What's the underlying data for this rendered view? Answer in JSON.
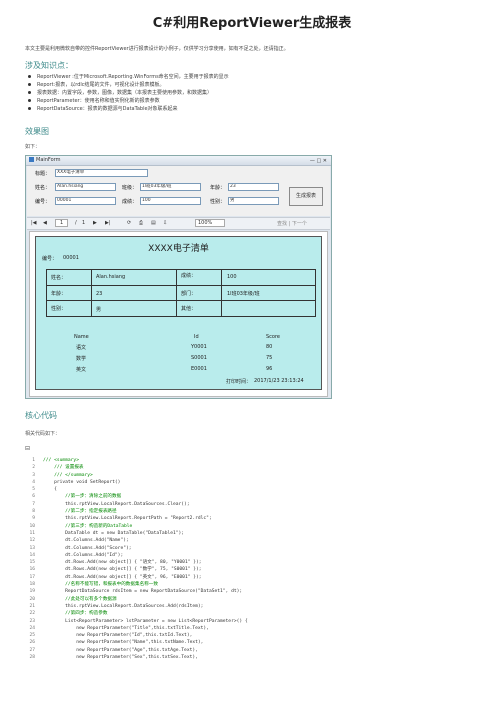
{
  "page": {
    "title": "C#利用ReportViewer生成报表",
    "intro": "本文主要是利用微软自带的控件ReportViewer进行报表设计的小例子，仅供学习分享使用，如有不足之处，还请指正。",
    "section_knowledge": "涉及知识点：",
    "knowledge_items": [
      "ReportViewer :位于Microsoft.Reporting.WinForms命名空间，主要用于报表的显示",
      "Report:报表，以rdlc结尾的文件，可视化设计报表模板。",
      "报表数据：内置字段，参数，图像，数据集（本报表主要使用参数，和数据集）",
      "ReportParameter：使用名称和值实例化新的报表参数",
      "ReportDataSource：报表的数据源与DataTable对象联系起来"
    ],
    "section_effect": "效果图",
    "effect_caption": "如下：",
    "section_code": "核心代码",
    "code_caption": "相关代码如下：",
    "code_toggle": "⊟"
  },
  "window": {
    "title": "MainForm",
    "controls": "— □ ✕",
    "labels": {
      "title": "标题：",
      "name": "姓名：",
      "class": "班级：",
      "age": "年龄：",
      "no": "编号：",
      "score": "成绩：",
      "sex": "性别："
    },
    "values": {
      "title": "XXX电子清单",
      "name": "Alan.hsiang",
      "class": "1l班03年级/班",
      "age": "23",
      "no": "00001",
      "score": "100",
      "sex": "男"
    },
    "generate_button": "生成报表",
    "toolbar": {
      "first": "|◀",
      "prev": "◀",
      "page": "1",
      "of": "/",
      "total": "1",
      "next": "▶",
      "last": "▶|",
      "zoom": "100%",
      "find": "查找 | 下一个"
    }
  },
  "report": {
    "title": "XXXX电子清单",
    "no_label": "编号：",
    "no_value": "00001",
    "name_label": "姓名：",
    "name_value": "Alan.hsiang",
    "score_label": "成绩：",
    "score_value": "100",
    "age_label": "年龄：",
    "age_value": "23",
    "dept_label": "部门：",
    "dept_value": "1l班03年级/班",
    "sex_label": "性别：",
    "sex_value": "男",
    "other_label": "其他：",
    "table_headers": [
      "Name",
      "Id",
      "Score"
    ],
    "table_rows": [
      [
        "语文",
        "Y0001",
        "80"
      ],
      [
        "数学",
        "S0001",
        "75"
      ],
      [
        "英文",
        "E0001",
        "96"
      ]
    ],
    "print_label": "打印时间：",
    "print_time": "2017/1/23 23:13:24"
  },
  "code_lines": [
    {
      "no": "1",
      "text": "/// <summary>"
    },
    {
      "no": "2",
      "text": "    /// 设置报表"
    },
    {
      "no": "3",
      "text": "    /// </summary>"
    },
    {
      "no": "4",
      "text": "    private void SetReport()"
    },
    {
      "no": "5",
      "text": "    {"
    },
    {
      "no": "6",
      "text": "        //第一步：清除之前的数据"
    },
    {
      "no": "7",
      "text": "        this.rptView.LocalReport.DataSources.Clear();"
    },
    {
      "no": "8",
      "text": "        //第二步：指定报表路径"
    },
    {
      "no": "9",
      "text": "        this.rptView.LocalReport.ReportPath = \"Report2.rdlc\";"
    },
    {
      "no": "10",
      "text": "        //第三步：构造新的DataTable"
    },
    {
      "no": "11",
      "text": "        DataTable dt = new DataTable(\"DataTable1\");"
    },
    {
      "no": "12",
      "text": "        dt.Columns.Add(\"Name\");"
    },
    {
      "no": "13",
      "text": "        dt.Columns.Add(\"Score\");"
    },
    {
      "no": "14",
      "text": "        dt.Columns.Add(\"Id\");"
    },
    {
      "no": "15",
      "text": "        dt.Rows.Add(new object[] { \"语文\", 80, \"Y0001\" });"
    },
    {
      "no": "16",
      "text": "        dt.Rows.Add(new object[] { \"数学\", 75, \"S0001\" });"
    },
    {
      "no": "17",
      "text": "        dt.Rows.Add(new object[] { \"英文\", 96, \"E0001\" });"
    },
    {
      "no": "18",
      "text": "        //名称不能写错，和报表中的数据集名称一致"
    },
    {
      "no": "19",
      "text": "        ReportDataSource rdsItem = new ReportDataSource(\"DataSet1\", dt);"
    },
    {
      "no": "20",
      "text": "        //此处可以有多个数据源"
    },
    {
      "no": "21",
      "text": "        this.rptView.LocalReport.DataSources.Add(rdsItem);"
    },
    {
      "no": "22",
      "text": "        //第四步：构造参数"
    },
    {
      "no": "23",
      "text": "        List<ReportParameter> lstParameter = new List<ReportParameter>() {"
    },
    {
      "no": "24",
      "text": "            new ReportParameter(\"Title\",this.txtTitle.Text),"
    },
    {
      "no": "25",
      "text": "            new ReportParameter(\"Id\",this.txtId.Text),"
    },
    {
      "no": "26",
      "text": "            new ReportParameter(\"Name\",this.txtName.Text),"
    },
    {
      "no": "27",
      "text": "            new ReportParameter(\"Age\",this.txtAge.Text),"
    },
    {
      "no": "28",
      "text": "            new ReportParameter(\"Sex\",this.txtSex.Text),"
    }
  ]
}
